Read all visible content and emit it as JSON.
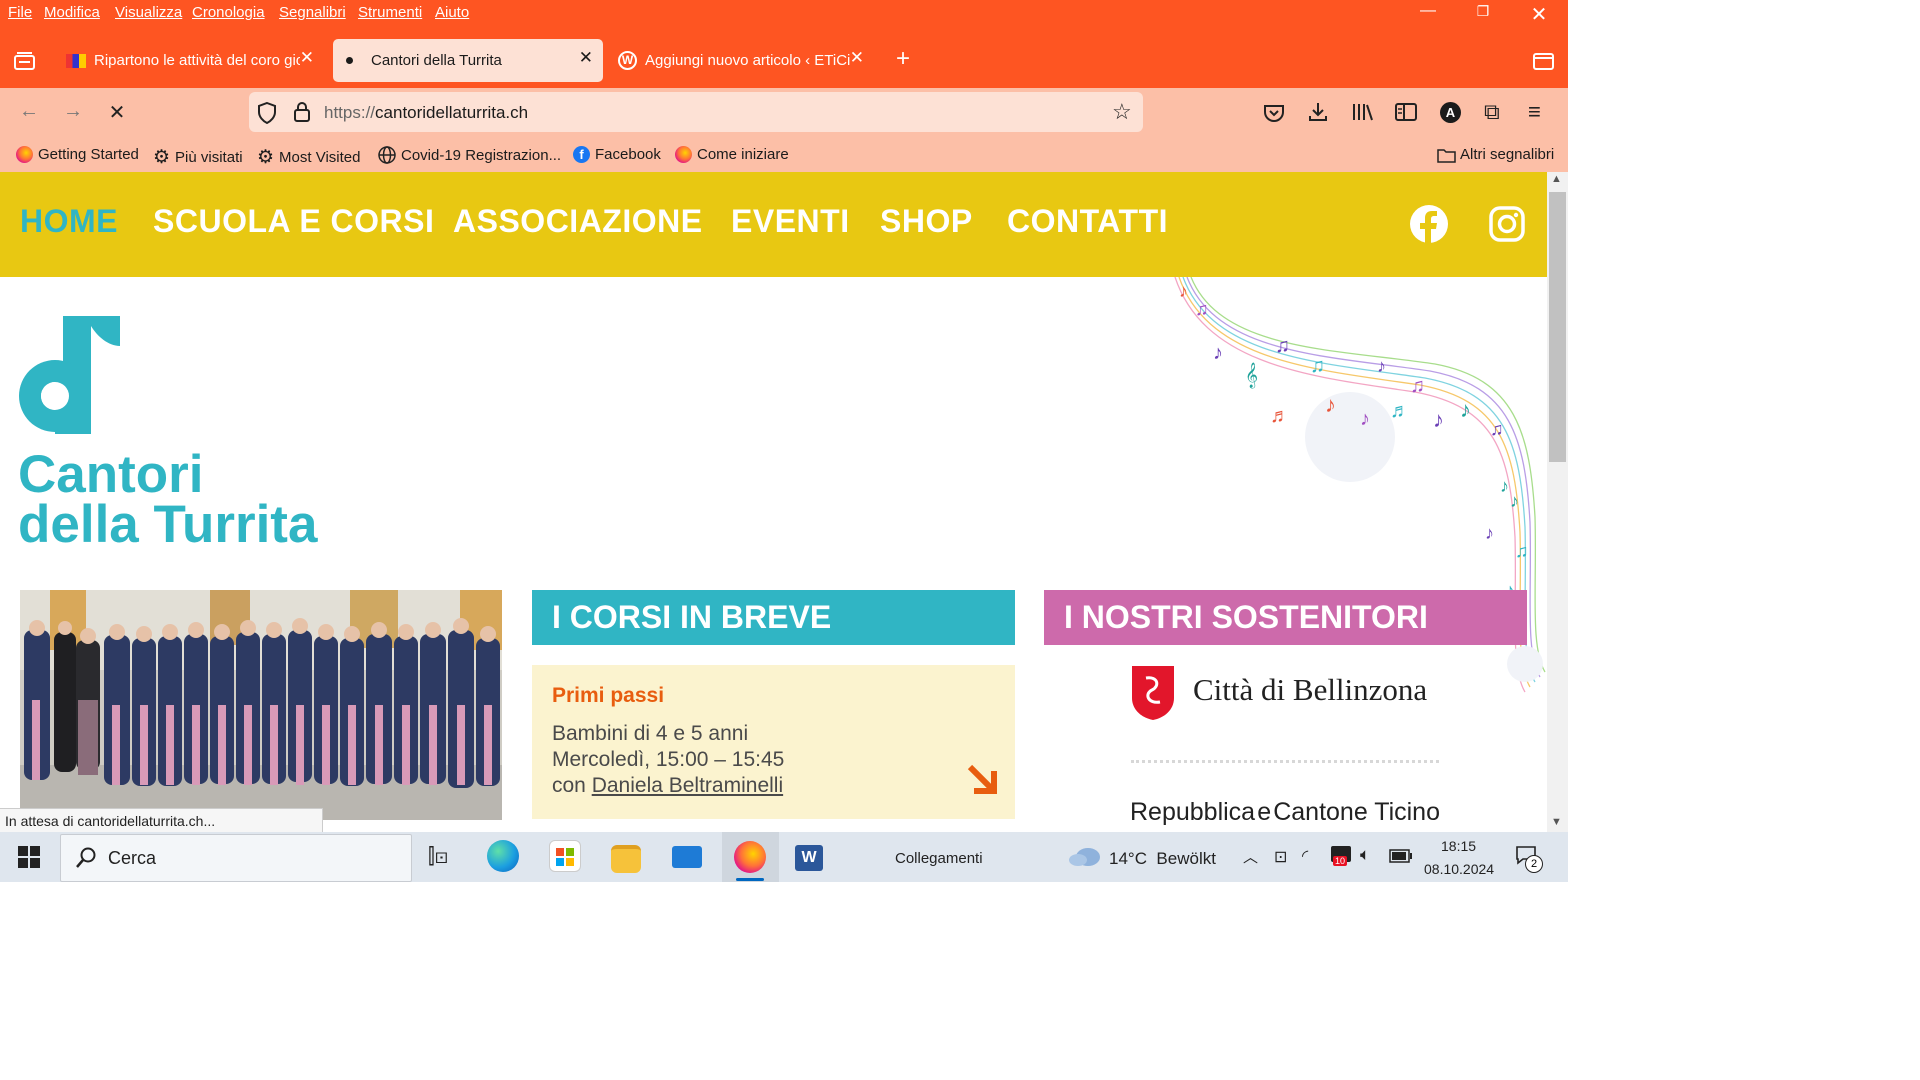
{
  "menubar": {
    "items": [
      "File",
      "Modifica",
      "Visualizza",
      "Cronologia",
      "Segnalibri",
      "Strumenti",
      "Aiuto"
    ]
  },
  "tabs": [
    {
      "title": "Ripartono le attività del coro gio",
      "active": false
    },
    {
      "title": "Cantori della Turrita",
      "active": true
    },
    {
      "title": "Aggiungi nuovo articolo ‹ ETiCin",
      "active": false
    }
  ],
  "navbar": {
    "url_prefix": "https://",
    "url_host": "cantoridellaturrita.ch"
  },
  "bookmarks": {
    "items": [
      {
        "label": "Getting Started",
        "icon": "firefox-icon"
      },
      {
        "label": "Più visitati",
        "icon": "gear-icon"
      },
      {
        "label": "Most Visited",
        "icon": "gear-icon"
      },
      {
        "label": "Covid-19 Registrazion...",
        "icon": "globe-icon"
      },
      {
        "label": "Facebook",
        "icon": "facebook-icon"
      },
      {
        "label": "Come iniziare",
        "icon": "firefox-icon"
      }
    ],
    "other": "Altri segnalibri"
  },
  "site": {
    "nav": [
      "HOME",
      "SCUOLA E CORSI",
      "ASSOCIAZIONE",
      "EVENTI",
      "SHOP",
      "CONTATTI"
    ],
    "active_nav": "HOME",
    "logo_line1": "Cantori",
    "logo_line2": "della Turrita",
    "courses_header": "I CORSI IN BREVE",
    "course": {
      "title": "Primi passi",
      "line1": "Bambini di 4 e 5 anni",
      "line2": "Mercoledì, 15:00 – 15:45",
      "line3_prefix": "con ",
      "teacher": "Daniela Beltraminelli"
    },
    "sponsors_header": "I NOSTRI SOSTENITORI",
    "sponsor1": "Città di Bellinzona",
    "sponsor2_a": "Repubblica",
    "sponsor2_b": "e",
    "sponsor2_c": "Cantone Ticino",
    "colors": {
      "yellow": "#e8c812",
      "teal": "#30b5c4",
      "pink": "#cd6aab",
      "orange": "#e85d0f",
      "cream": "#fbf3cf"
    }
  },
  "status": "In attesa di cantoridellaturrita.ch...",
  "taskbar": {
    "search": "Cerca",
    "links": "Collegamenti",
    "weather": "14°C  Bewölkt",
    "time": "18:15",
    "date": "08.10.2024",
    "notif_count": "2",
    "badge_count": "10"
  }
}
